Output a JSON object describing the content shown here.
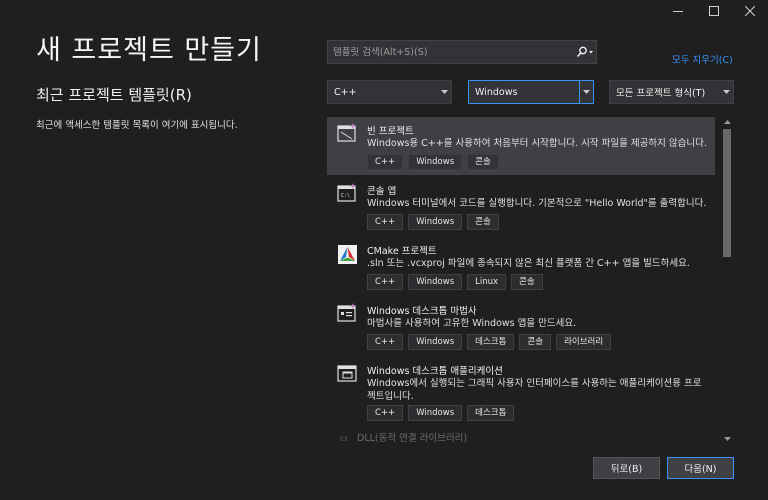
{
  "window": {
    "minimize_icon": "minimize-icon",
    "maximize_icon": "maximize-icon",
    "close_icon": "close-icon"
  },
  "page_title": "새 프로젝트 만들기",
  "recent": {
    "heading": "최근 프로젝트 템플릿(R)",
    "empty_text": "최근에 액세스한 템플릿 목록이 여기에 표시됩니다."
  },
  "search": {
    "placeholder": "템플릿 검색(Alt+S)(S)",
    "icon": "search-icon",
    "clear_all": "모두 지우기(C)"
  },
  "filters": {
    "language": "C++",
    "platform": "Windows",
    "project_type": "모든 프로젝트 형식(T)"
  },
  "templates": [
    {
      "name": "빈 프로젝트",
      "description": "Windows용 C++를 사용하여 처음부터 시작합니다. 시작 파일을 제공하지 않습니다.",
      "tags": [
        "C++",
        "Windows",
        "콘솔"
      ],
      "icon": "empty-project-icon",
      "selected": true
    },
    {
      "name": "콘솔 앱",
      "description": "Windows 터미널에서 코드를 실행합니다. 기본적으로 \"Hello World\"를 출력합니다.",
      "tags": [
        "C++",
        "Windows",
        "콘솔"
      ],
      "icon": "console-app-icon",
      "selected": false
    },
    {
      "name": "CMake 프로젝트",
      "description": ".sln 또는 .vcxproj 파일에 종속되지 않은 최신 플랫폼 간 C++ 앱을 빌드하세요.",
      "tags": [
        "C++",
        "Windows",
        "Linux",
        "콘솔"
      ],
      "icon": "cmake-icon",
      "selected": false
    },
    {
      "name": "Windows 데스크톱 마법사",
      "description": "마법사를 사용하여 고유한 Windows 앱을 만드세요.",
      "tags": [
        "C++",
        "Windows",
        "데스크톱",
        "콘솔",
        "라이브러리"
      ],
      "icon": "desktop-wizard-icon",
      "selected": false
    },
    {
      "name": "Windows 데스크톱 애플리케이션",
      "description": "Windows에서 실행되는 그래픽 사용자 인터페이스를 사용하는 애플리케이션용 프로젝트입니다.",
      "tags": [
        "C++",
        "Windows",
        "데스크톱"
      ],
      "icon": "desktop-application-icon",
      "selected": false
    }
  ],
  "partial_template_name": "DLL(동적 연결 라이브러리)",
  "buttons": {
    "back": "뒤로(B)",
    "next": "다음(N)"
  },
  "colors": {
    "background": "#1f1f1f",
    "accent": "#3794ff",
    "selected_row": "#3f3f46"
  }
}
